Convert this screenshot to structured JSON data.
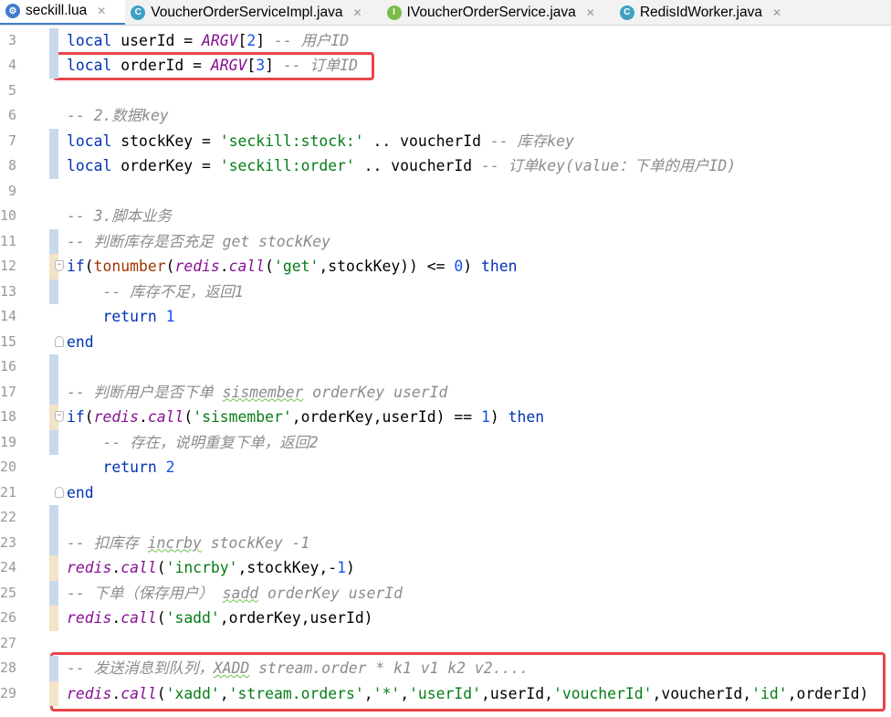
{
  "tabs": [
    {
      "label": "seckill.lua",
      "icon": "lua-file-icon",
      "icon_char": "⚙",
      "icon_color": "#3f7ccf",
      "active": true
    },
    {
      "label": "VoucherOrderServiceImpl.java",
      "icon": "java-class-icon",
      "icon_char": "C",
      "icon_color": "#3fa2c4",
      "active": false
    },
    {
      "label": "IVoucherOrderService.java",
      "icon": "java-interface-icon",
      "icon_char": "I",
      "icon_color": "#7dbb4a",
      "active": false
    },
    {
      "label": "RedisIdWorker.java",
      "icon": "java-class-icon",
      "icon_char": "C",
      "icon_color": "#3fa2c4",
      "active": false
    }
  ],
  "tab_close_glyph": "✕",
  "colors": {
    "keyword": "#0033b3",
    "function": "#871094",
    "builtin": "#9e3500",
    "string": "#067d17",
    "number": "#1750eb",
    "comment": "#8c8c8c",
    "highlight_box": "#e8454b",
    "tab_active_underline": "#4083c9"
  },
  "lines": [
    {
      "num": "3",
      "mark": "blue",
      "fold": "",
      "tokens": [
        [
          "kw",
          "local "
        ],
        [
          "id",
          "userId = "
        ],
        [
          "fn",
          "ARGV"
        ],
        [
          "id",
          "["
        ],
        [
          "num",
          "2"
        ],
        [
          "id",
          "] "
        ],
        [
          "cm",
          "-- 用户ID"
        ]
      ]
    },
    {
      "num": "4",
      "mark": "blue",
      "fold": "",
      "tokens": [
        [
          "kw",
          "local "
        ],
        [
          "id",
          "orderId = "
        ],
        [
          "fn",
          "ARGV"
        ],
        [
          "id",
          "["
        ],
        [
          "num",
          "3"
        ],
        [
          "id",
          "] "
        ],
        [
          "cm",
          "-- 订单ID"
        ]
      ]
    },
    {
      "num": "5",
      "mark": "",
      "fold": "",
      "tokens": []
    },
    {
      "num": "6",
      "mark": "",
      "fold": "",
      "tokens": [
        [
          "cm",
          "-- 2.数据key"
        ]
      ]
    },
    {
      "num": "7",
      "mark": "blue",
      "fold": "",
      "tokens": [
        [
          "kw",
          "local "
        ],
        [
          "id",
          "stockKey = "
        ],
        [
          "str",
          "'seckill:stock:'"
        ],
        [
          "id",
          " .. voucherId "
        ],
        [
          "cm",
          "-- 库存key"
        ]
      ]
    },
    {
      "num": "8",
      "mark": "blue",
      "fold": "",
      "tokens": [
        [
          "kw",
          "local "
        ],
        [
          "id",
          "orderKey = "
        ],
        [
          "str",
          "'seckill:order'"
        ],
        [
          "id",
          " .. voucherId "
        ],
        [
          "cm",
          "-- 订单key(value：下单的用户ID)"
        ]
      ]
    },
    {
      "num": "9",
      "mark": "",
      "fold": "",
      "tokens": []
    },
    {
      "num": "10",
      "mark": "",
      "fold": "",
      "tokens": [
        [
          "cm",
          "-- 3.脚本业务"
        ]
      ]
    },
    {
      "num": "11",
      "mark": "blue",
      "fold": "",
      "tokens": [
        [
          "cm",
          "-- 判断库存是否充足 get stockKey"
        ]
      ]
    },
    {
      "num": "12",
      "mark": "tan",
      "fold": "start",
      "tokens": [
        [
          "kw",
          "if"
        ],
        [
          "id",
          "("
        ],
        [
          "builtin",
          "tonumber"
        ],
        [
          "id",
          "("
        ],
        [
          "fn",
          "redis"
        ],
        [
          "id",
          "."
        ],
        [
          "fn",
          "call"
        ],
        [
          "id",
          "("
        ],
        [
          "str",
          "'get'"
        ],
        [
          "id",
          ",stockKey)) <= "
        ],
        [
          "num",
          "0"
        ],
        [
          "id",
          ") "
        ],
        [
          "kw",
          "then"
        ]
      ]
    },
    {
      "num": "13",
      "mark": "blue",
      "fold": "",
      "tokens": [
        [
          "id",
          "    "
        ],
        [
          "cm",
          "-- 库存不足，返回1"
        ]
      ]
    },
    {
      "num": "14",
      "mark": "",
      "fold": "",
      "tokens": [
        [
          "id",
          "    "
        ],
        [
          "kw",
          "return "
        ],
        [
          "num",
          "1"
        ]
      ]
    },
    {
      "num": "15",
      "mark": "",
      "fold": "end",
      "tokens": [
        [
          "kw",
          "end"
        ]
      ]
    },
    {
      "num": "16",
      "mark": "blue",
      "fold": "",
      "tokens": []
    },
    {
      "num": "17",
      "mark": "blue",
      "fold": "",
      "tokens": [
        [
          "cm",
          "-- 判断用户是否下单 "
        ],
        [
          "cmu",
          "sismember"
        ],
        [
          "cm",
          " orderKey userId"
        ]
      ]
    },
    {
      "num": "18",
      "mark": "tan",
      "fold": "start",
      "tokens": [
        [
          "kw",
          "if"
        ],
        [
          "id",
          "("
        ],
        [
          "fn",
          "redis"
        ],
        [
          "id",
          "."
        ],
        [
          "fn",
          "call"
        ],
        [
          "id",
          "("
        ],
        [
          "str",
          "'sismember'"
        ],
        [
          "id",
          ",orderKey,userId) == "
        ],
        [
          "num",
          "1"
        ],
        [
          "id",
          ") "
        ],
        [
          "kw",
          "then"
        ]
      ]
    },
    {
      "num": "19",
      "mark": "blue",
      "fold": "",
      "tokens": [
        [
          "id",
          "    "
        ],
        [
          "cm",
          "-- 存在，说明重复下单，返回2"
        ]
      ]
    },
    {
      "num": "20",
      "mark": "",
      "fold": "",
      "tokens": [
        [
          "id",
          "    "
        ],
        [
          "kw",
          "return "
        ],
        [
          "num",
          "2"
        ]
      ]
    },
    {
      "num": "21",
      "mark": "",
      "fold": "end",
      "tokens": [
        [
          "kw",
          "end"
        ]
      ]
    },
    {
      "num": "22",
      "mark": "blue",
      "fold": "",
      "tokens": []
    },
    {
      "num": "23",
      "mark": "blue",
      "fold": "",
      "tokens": [
        [
          "cm",
          "-- 扣库存 "
        ],
        [
          "cmu",
          "incrby"
        ],
        [
          "cm",
          " stockKey -1"
        ]
      ]
    },
    {
      "num": "24",
      "mark": "tan",
      "fold": "",
      "tokens": [
        [
          "fn",
          "redis"
        ],
        [
          "id",
          "."
        ],
        [
          "fn",
          "call"
        ],
        [
          "id",
          "("
        ],
        [
          "str",
          "'incrby'"
        ],
        [
          "id",
          ",stockKey,-"
        ],
        [
          "num",
          "1"
        ],
        [
          "id",
          ")"
        ]
      ]
    },
    {
      "num": "25",
      "mark": "blue",
      "fold": "",
      "tokens": [
        [
          "cm",
          "-- 下单（保存用户） "
        ],
        [
          "cmu",
          "sadd"
        ],
        [
          "cm",
          " orderKey userId"
        ]
      ]
    },
    {
      "num": "26",
      "mark": "tan",
      "fold": "",
      "tokens": [
        [
          "fn",
          "redis"
        ],
        [
          "id",
          "."
        ],
        [
          "fn",
          "call"
        ],
        [
          "id",
          "("
        ],
        [
          "str",
          "'sadd'"
        ],
        [
          "id",
          ",orderKey,userId)"
        ]
      ]
    },
    {
      "num": "27",
      "mark": "",
      "fold": "",
      "tokens": []
    },
    {
      "num": "28",
      "mark": "blue",
      "fold": "",
      "tokens": [
        [
          "cm",
          "-- 发送消息到队列，"
        ],
        [
          "cmu",
          "XADD"
        ],
        [
          "cm",
          " stream.order * k1 v1 k2 v2...."
        ]
      ]
    },
    {
      "num": "29",
      "mark": "tan",
      "fold": "",
      "tokens": [
        [
          "fn",
          "redis"
        ],
        [
          "id",
          "."
        ],
        [
          "fn",
          "call"
        ],
        [
          "id",
          "("
        ],
        [
          "str",
          "'xadd'"
        ],
        [
          "id",
          ","
        ],
        [
          "str",
          "'stream.orders'"
        ],
        [
          "id",
          ","
        ],
        [
          "str",
          "'*'"
        ],
        [
          "id",
          ","
        ],
        [
          "str",
          "'userId'"
        ],
        [
          "id",
          ",userId,"
        ],
        [
          "str",
          "'voucherId'"
        ],
        [
          "id",
          ",voucherId,"
        ],
        [
          "str",
          "'id'"
        ],
        [
          "id",
          ",orderId)"
        ]
      ]
    }
  ]
}
